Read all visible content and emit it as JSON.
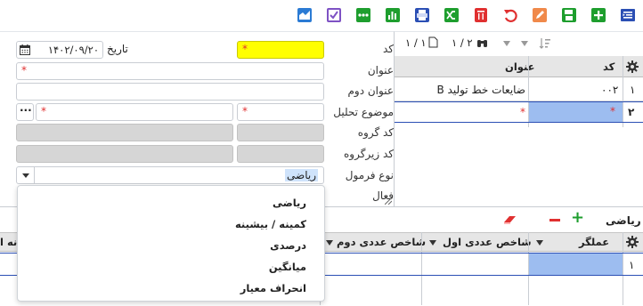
{
  "toolbar": {
    "buttons": [
      {
        "name": "menu-toggle-button",
        "icon": "list-indent-icon",
        "color": "#2b4fb4"
      },
      {
        "name": "add-button",
        "icon": "plus-icon",
        "color": "#1e9e2e"
      },
      {
        "name": "save-button",
        "icon": "save-icon",
        "color": "#1e9e2e"
      },
      {
        "name": "edit-button",
        "icon": "edit-icon",
        "color": "#e06a2a"
      },
      {
        "name": "undo-button",
        "icon": "undo-icon",
        "color": "#e03030"
      },
      {
        "name": "delete-button",
        "icon": "trash-icon",
        "color": "#e03030"
      },
      {
        "name": "shuffle-button",
        "icon": "shuffle-icon",
        "color": "#1e9e2e"
      },
      {
        "name": "print-button",
        "icon": "print-icon",
        "color": "#2b4fb4"
      },
      {
        "name": "chart-button",
        "icon": "bar-chart-icon",
        "color": "#1e9e2e"
      },
      {
        "name": "more-button",
        "icon": "more-icon",
        "color": "#1e9e2e"
      },
      {
        "name": "check-button",
        "icon": "checkbox-icon",
        "color": "#6a3ab4"
      },
      {
        "name": "area-chart-button",
        "icon": "area-chart-icon",
        "color": "#2b7bd4"
      }
    ]
  },
  "form": {
    "code_label": "کد",
    "code_required": "*",
    "date_label": "تاریخ",
    "date_value": "۱۴۰۲/۰۹/۲۰",
    "title_label": "عنوان",
    "title_required": "*",
    "title2_label": "عنوان دوم",
    "subject_label": "موضوع تحلیل",
    "subject_required": "*",
    "subject2_required": "*",
    "group_code_label": "کد گروه",
    "subgroup_code_label": "کد زیرگروه",
    "formula_type_label": "نوع فرمول",
    "formula_type_value": "ریاضی",
    "active_label": "فعال"
  },
  "dropdown": {
    "options": [
      "ریاضی",
      "کمینه / بیشینه",
      "درصدی",
      "میانگین",
      "انحراف معیار"
    ]
  },
  "grid1": {
    "pager_right": "۱ / ۲",
    "pager_left": "۱ / ۱",
    "col_code": "کد",
    "col_title": "عنوان",
    "rows": [
      {
        "num": "۱",
        "code": "۰۰۲",
        "title": "ضایعات خط تولید B"
      },
      {
        "num": "۲",
        "code": "*",
        "title": "*"
      }
    ]
  },
  "bottom": {
    "title": "ریاضی",
    "col_operator": "عملگر",
    "col_index1": "شاخص عددی اول",
    "col_index2": "شاخص عددی دوم",
    "col_partial": "نه ا",
    "row_num": "۱"
  },
  "colors": {
    "accent_blue": "#9dbdf0",
    "required_red": "#e03030",
    "header_gray": "#e6e6e6"
  }
}
